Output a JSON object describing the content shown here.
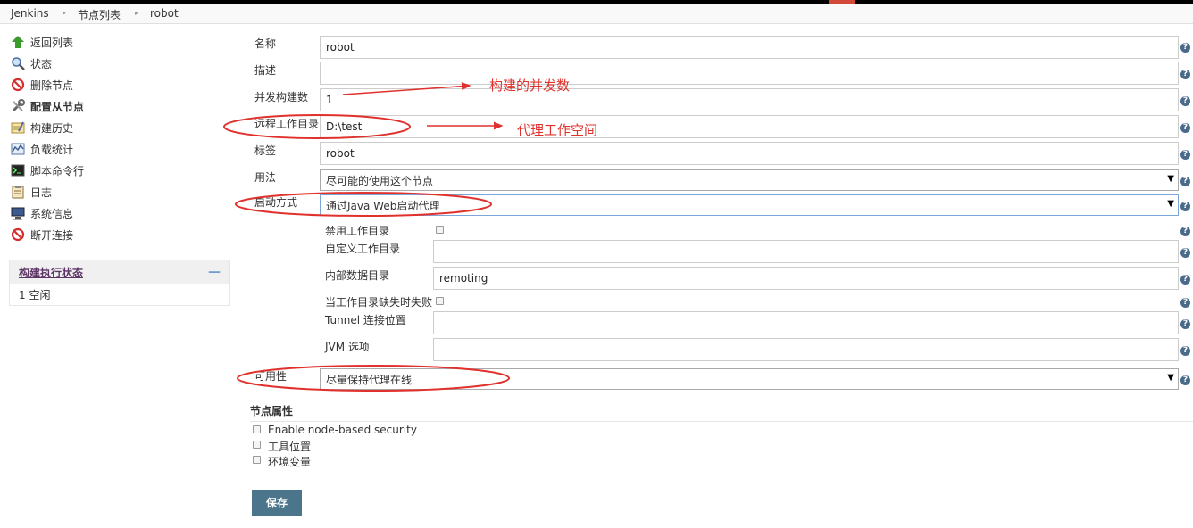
{
  "breadcrumb": [
    "Jenkins",
    "节点列表",
    "robot"
  ],
  "sidebar": {
    "items": [
      {
        "label": "返回列表",
        "icon": "up-arrow-icon"
      },
      {
        "label": "状态",
        "icon": "search-icon"
      },
      {
        "label": "删除节点",
        "icon": "no-entry-icon"
      },
      {
        "label": "配置从节点",
        "icon": "wrench-icon"
      },
      {
        "label": "构建历史",
        "icon": "notepad-icon"
      },
      {
        "label": "负载统计",
        "icon": "chart-icon"
      },
      {
        "label": "脚本命令行",
        "icon": "terminal-icon"
      },
      {
        "label": "日志",
        "icon": "clipboard-icon"
      },
      {
        "label": "系统信息",
        "icon": "computer-icon"
      },
      {
        "label": "断开连接",
        "icon": "no-entry-icon"
      }
    ],
    "executor": {
      "title": "构建执行状态",
      "collapse": "—",
      "row": "1  空闲"
    }
  },
  "form": {
    "name": {
      "label": "名称",
      "value": "robot"
    },
    "description": {
      "label": "描述",
      "value": ""
    },
    "executors": {
      "label": "并发构建数",
      "value": "1"
    },
    "remote_fs": {
      "label": "远程工作目录",
      "value": "D:\\test"
    },
    "labels": {
      "label": "标签",
      "value": "robot"
    },
    "usage": {
      "label": "用法",
      "value": "尽可能的使用这个节点"
    },
    "launch": {
      "label": "启动方式",
      "value": "通过Java Web启动代理"
    },
    "disable_workdir": {
      "label": "禁用工作目录"
    },
    "custom_workdir": {
      "label": "自定义工作目录",
      "value": ""
    },
    "internal_dir": {
      "label": "内部数据目录",
      "value": "remoting"
    },
    "fail_if_missing": {
      "label": "当工作目录缺失时失败"
    },
    "tunnel": {
      "label": "Tunnel 连接位置",
      "value": ""
    },
    "jvm": {
      "label": "JVM 选项",
      "value": ""
    },
    "availability": {
      "label": "可用性",
      "value": "尽量保持代理在线"
    }
  },
  "node_properties": {
    "title": "节点属性",
    "items": [
      "Enable node-based security",
      "工具位置",
      "环境变量"
    ]
  },
  "save_label": "保存",
  "help_glyph": "?",
  "select_arrow": "▼",
  "annotations": {
    "executors_note": "构建的并发数",
    "remote_note": "代理工作空间"
  },
  "colors": {
    "accent": "#4b758b",
    "annotation": "#e0312c"
  }
}
